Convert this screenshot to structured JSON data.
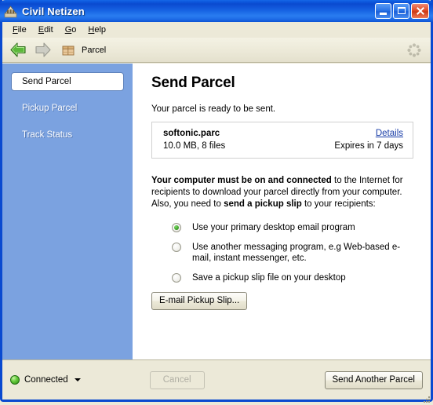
{
  "window": {
    "title": "Civil Netizen",
    "app_icon": "building-icon",
    "controls": {
      "minimize": "minimize-button",
      "maximize": "maximize-button",
      "close": "close-button"
    }
  },
  "menubar": {
    "items": [
      {
        "label": "File",
        "accel": "F"
      },
      {
        "label": "Edit",
        "accel": "E"
      },
      {
        "label": "Go",
        "accel": "G"
      },
      {
        "label": "Help",
        "accel": "H"
      }
    ]
  },
  "toolbar": {
    "back_icon": "back-arrow-icon",
    "forward_icon": "forward-arrow-icon",
    "location_icon": "parcel-box-icon",
    "location_label": "Parcel",
    "brand_icon": "flower-logo-icon"
  },
  "sidebar": {
    "items": [
      {
        "label": "Send Parcel",
        "selected": true
      },
      {
        "label": "Pickup Parcel",
        "selected": false
      },
      {
        "label": "Track Status",
        "selected": false
      }
    ]
  },
  "main": {
    "title": "Send Parcel",
    "subtitle": "Your parcel is ready to be sent.",
    "parcel": {
      "name": "softonic.parc",
      "meta": "10.0 MB, 8 files",
      "details_link": "Details",
      "expiry": "Expires in 7 days"
    },
    "notice": {
      "bold_1": "Your computer must be on and connected",
      "text_1": " to the Internet for recipients to download your parcel directly from your computer. Also, you need to ",
      "bold_2": "send a pickup slip",
      "text_2": " to your recipients:"
    },
    "radio_options": [
      {
        "label": "Use your primary desktop email program",
        "checked": true
      },
      {
        "label": "Use another messaging program, e.g Web-based e-mail, instant messenger, etc.",
        "checked": false
      },
      {
        "label": "Save a pickup slip file on your desktop",
        "checked": false
      }
    ],
    "email_button": "E-mail Pickup Slip..."
  },
  "statusbar": {
    "connection_status": "Connected",
    "connection_icon": "green-status-dot-icon",
    "dropdown_icon": "caret-down-icon",
    "cancel_button": "Cancel",
    "cancel_disabled": true,
    "primary_button": "Send Another Parcel",
    "resize_grip": "resize-grip-icon"
  },
  "colors": {
    "title_bar_blue": "#0a4ad0",
    "sidebar_blue": "#7ba2e0",
    "chrome_beige": "#ece9d8",
    "link_blue": "#1a3ea8",
    "status_green": "#3fa32a"
  }
}
